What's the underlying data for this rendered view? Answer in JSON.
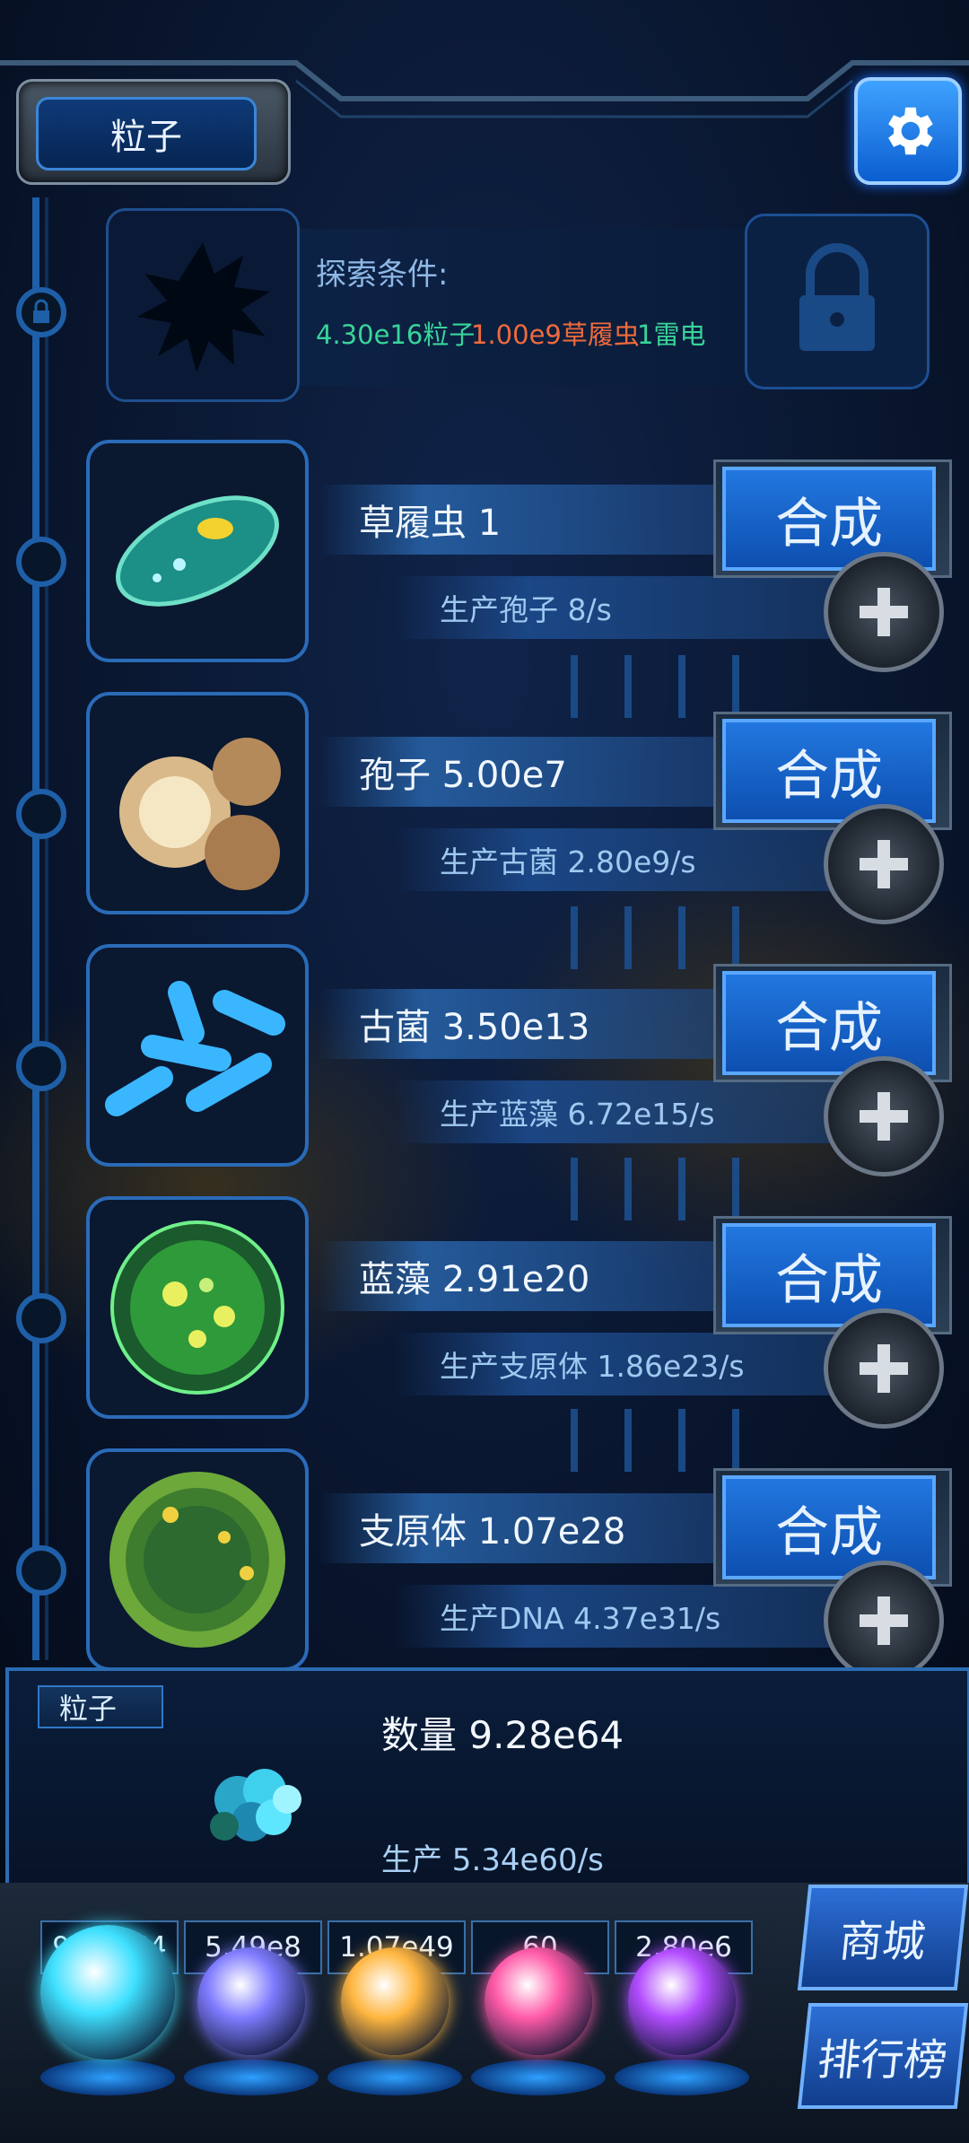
{
  "header": {
    "title": "粒子",
    "settings_icon": "gear-icon"
  },
  "explore": {
    "label": "探索条件:",
    "conditions": [
      {
        "text": "4.30e16粒子",
        "color": "#39d49a"
      },
      {
        "text": "1.00e9草履虫",
        "color": "#f06a3c"
      },
      {
        "text": "1雷电",
        "color": "#39d49a"
      }
    ]
  },
  "units": [
    {
      "name": "草履虫 1",
      "production": "生产孢子 8/s",
      "synth_label": "合成"
    },
    {
      "name": "孢子 5.00e7",
      "production": "生产古菌 2.80e9/s",
      "synth_label": "合成"
    },
    {
      "name": "古菌 3.50e13",
      "production": "生产蓝藻 6.72e15/s",
      "synth_label": "合成"
    },
    {
      "name": "蓝藻 2.91e20",
      "production": "生产支原体 1.86e23/s",
      "synth_label": "合成"
    },
    {
      "name": "支原体 1.07e28",
      "production": "生产DNA 4.37e31/s",
      "synth_label": "合成"
    }
  ],
  "summary": {
    "tag": "粒子",
    "quantity": "数量 9.28e64",
    "production": "生产 5.34e60/s"
  },
  "resources": [
    {
      "value": "9.28e64",
      "orb_color": "#3fe0ff"
    },
    {
      "value": "5.49e8",
      "orb_color": "#7f7bff"
    },
    {
      "value": "1.07e49",
      "orb_color": "#ffb640"
    },
    {
      "value": "60",
      "orb_color": "#ff5aa8"
    },
    {
      "value": "2.80e6",
      "orb_color": "#b24cff"
    }
  ],
  "side_buttons": {
    "shop": "商城",
    "ranking": "排行榜"
  }
}
